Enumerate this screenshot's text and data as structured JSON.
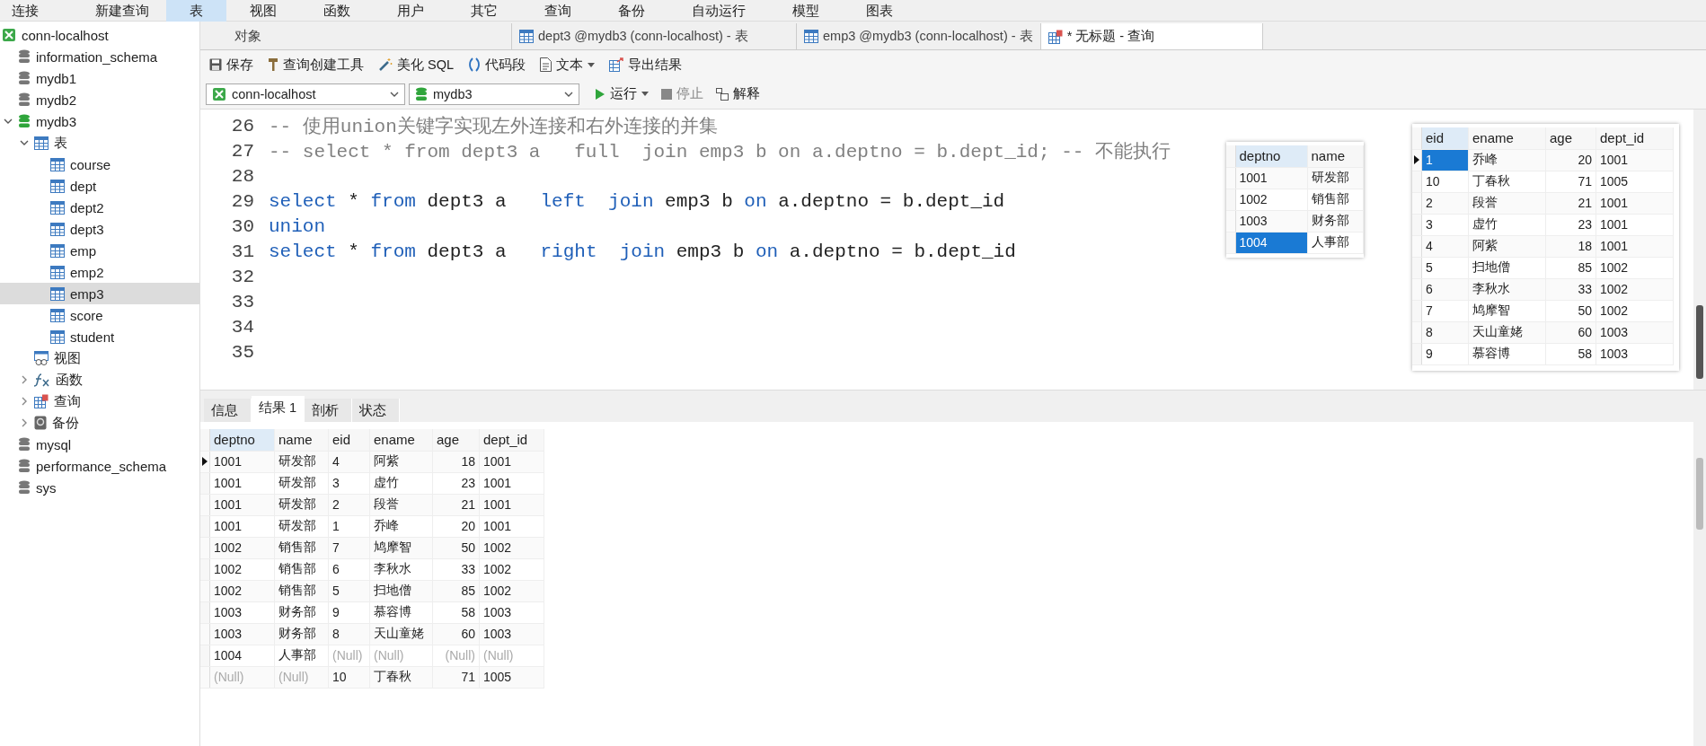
{
  "menu": [
    {
      "label": "连接",
      "selected": false
    },
    {
      "label": "新建查询",
      "selected": false
    },
    {
      "label": "表",
      "selected": true
    },
    {
      "label": "视图",
      "selected": false
    },
    {
      "label": "函数",
      "selected": false
    },
    {
      "label": "用户",
      "selected": false
    },
    {
      "label": "其它",
      "selected": false
    },
    {
      "label": "查询",
      "selected": false
    },
    {
      "label": "备份",
      "selected": false
    },
    {
      "label": "自动运行",
      "selected": false
    },
    {
      "label": "模型",
      "selected": false
    },
    {
      "label": "图表",
      "selected": false
    }
  ],
  "sidebar": {
    "items": [
      {
        "label": "conn-localhost",
        "kind": "connection",
        "selected": false
      },
      {
        "label": "information_schema",
        "kind": "database",
        "open": false,
        "selected": false
      },
      {
        "label": "mydb1",
        "kind": "database",
        "open": false,
        "selected": false
      },
      {
        "label": "mydb2",
        "kind": "database",
        "open": false,
        "selected": false
      },
      {
        "label": "mydb3",
        "kind": "database",
        "open": true,
        "expanded": true,
        "selected": false,
        "children": [
          {
            "label": "表",
            "kind": "tables",
            "expanded": true,
            "selected": false,
            "children": [
              {
                "label": "course",
                "kind": "table",
                "selected": false
              },
              {
                "label": "dept",
                "kind": "table",
                "selected": false
              },
              {
                "label": "dept2",
                "kind": "table",
                "selected": false
              },
              {
                "label": "dept3",
                "kind": "table",
                "selected": false
              },
              {
                "label": "emp",
                "kind": "table",
                "selected": false
              },
              {
                "label": "emp2",
                "kind": "table",
                "selected": false
              },
              {
                "label": "emp3",
                "kind": "table",
                "selected": true
              },
              {
                "label": "score",
                "kind": "table",
                "selected": false
              },
              {
                "label": "student",
                "kind": "table",
                "selected": false
              }
            ]
          },
          {
            "label": "视图",
            "kind": "views",
            "selected": false
          },
          {
            "label": "函数",
            "kind": "functions",
            "expanded": false,
            "selected": false
          },
          {
            "label": "查询",
            "kind": "queries",
            "expanded": false,
            "selected": false
          },
          {
            "label": "备份",
            "kind": "backups",
            "expanded": false,
            "selected": false
          }
        ]
      },
      {
        "label": "mysql",
        "kind": "database",
        "open": false,
        "selected": false
      },
      {
        "label": "performance_schema",
        "kind": "database",
        "open": false,
        "selected": false
      },
      {
        "label": "sys",
        "kind": "database",
        "open": false,
        "selected": false
      }
    ]
  },
  "document_tabs": [
    {
      "label": "对象",
      "kind": "objects",
      "selected": false
    },
    {
      "label": "dept3 @mydb3 (conn-localhost) - 表",
      "kind": "table",
      "selected": false
    },
    {
      "label": "emp3 @mydb3 (conn-localhost) - 表",
      "kind": "table",
      "selected": false
    },
    {
      "label": "* 无标题 - 查询",
      "kind": "query",
      "selected": true
    }
  ],
  "toolbar": [
    {
      "label": "保存",
      "kind": "save"
    },
    {
      "label": "查询创建工具",
      "kind": "builder"
    },
    {
      "label": "美化 SQL",
      "kind": "beautify"
    },
    {
      "label": "代码段",
      "kind": "snippet"
    },
    {
      "label": "文本",
      "kind": "text"
    },
    {
      "label": "导出结果",
      "kind": "export"
    }
  ],
  "query_bar": {
    "connection": "conn-localhost",
    "database": "mydb3",
    "actions": [
      {
        "label": "运行",
        "kind": "run"
      },
      {
        "label": "停止",
        "kind": "stop"
      },
      {
        "label": "解释",
        "kind": "explain"
      }
    ]
  },
  "editor": {
    "lines": [
      {
        "number": "26",
        "tokens": [
          {
            "kind": "comment",
            "text": "-- 使用union关键字实现左外连接和右外连接的并集"
          }
        ]
      },
      {
        "number": "27",
        "tokens": [
          {
            "kind": "comment",
            "text": "-- select * from dept3 a   full  join emp3 b on a.deptno = b.dept_id; -- 不能执行"
          }
        ]
      },
      {
        "number": "28"
      },
      {
        "number": "29",
        "tokens": [
          {
            "kind": "keyword",
            "text": "select"
          },
          {
            "kind": "plain",
            "text": " * "
          },
          {
            "kind": "keyword",
            "text": "from"
          },
          {
            "kind": "plain",
            "text": " dept3 a   "
          },
          {
            "kind": "keyword",
            "text": "left  join"
          },
          {
            "kind": "plain",
            "text": " emp3 b "
          },
          {
            "kind": "keyword",
            "text": "on"
          },
          {
            "kind": "plain",
            "text": " a.deptno = b.dept_id"
          }
        ]
      },
      {
        "number": "30",
        "tokens": [
          {
            "kind": "keyword",
            "text": "union"
          }
        ]
      },
      {
        "number": "31",
        "tokens": [
          {
            "kind": "keyword",
            "text": "select"
          },
          {
            "kind": "plain",
            "text": " * "
          },
          {
            "kind": "keyword",
            "text": "from"
          },
          {
            "kind": "plain",
            "text": " dept3 a   "
          },
          {
            "kind": "keyword",
            "text": "right  join"
          },
          {
            "kind": "plain",
            "text": " emp3 b "
          },
          {
            "kind": "keyword",
            "text": "on"
          },
          {
            "kind": "plain",
            "text": " a.deptno = b.dept_id"
          }
        ]
      },
      {
        "number": "32"
      },
      {
        "number": "33"
      },
      {
        "number": "34"
      },
      {
        "number": "35"
      }
    ]
  },
  "dept_table": {
    "columns": [
      {
        "label": "deptno",
        "numeric": false
      },
      {
        "label": "name",
        "numeric": false
      }
    ],
    "rows": [
      {
        "current": false,
        "selected": false,
        "cells": [
          "1001",
          "研发部"
        ]
      },
      {
        "current": false,
        "selected": false,
        "cells": [
          "1002",
          "销售部"
        ]
      },
      {
        "current": false,
        "selected": false,
        "cells": [
          "1003",
          "财务部"
        ]
      },
      {
        "current": false,
        "selected": true,
        "cells": [
          "1004",
          "人事部"
        ]
      }
    ]
  },
  "emp_table": {
    "columns": [
      {
        "label": "eid",
        "numeric": false
      },
      {
        "label": "ename",
        "numeric": false
      },
      {
        "label": "age",
        "numeric": true
      },
      {
        "label": "dept_id",
        "numeric": false
      }
    ],
    "rows": [
      {
        "current": true,
        "selected": true,
        "cells": [
          "1",
          "乔峰",
          "20",
          "1001"
        ]
      },
      {
        "current": false,
        "selected": false,
        "cells": [
          "10",
          "丁春秋",
          "71",
          "1005"
        ]
      },
      {
        "current": false,
        "selected": false,
        "cells": [
          "2",
          "段誉",
          "21",
          "1001"
        ]
      },
      {
        "current": false,
        "selected": false,
        "cells": [
          "3",
          "虚竹",
          "23",
          "1001"
        ]
      },
      {
        "current": false,
        "selected": false,
        "cells": [
          "4",
          "阿紫",
          "18",
          "1001"
        ]
      },
      {
        "current": false,
        "selected": false,
        "cells": [
          "5",
          "扫地僧",
          "85",
          "1002"
        ]
      },
      {
        "current": false,
        "selected": false,
        "cells": [
          "6",
          "李秋水",
          "33",
          "1002"
        ]
      },
      {
        "current": false,
        "selected": false,
        "cells": [
          "7",
          "鸠摩智",
          "50",
          "1002"
        ]
      },
      {
        "current": false,
        "selected": false,
        "cells": [
          "8",
          "天山童姥",
          "60",
          "1003"
        ]
      },
      {
        "current": false,
        "selected": false,
        "cells": [
          "9",
          "慕容博",
          "58",
          "1003"
        ]
      }
    ]
  },
  "result_tabs": [
    {
      "label": "信息",
      "selected": false
    },
    {
      "label": "结果 1",
      "selected": true
    },
    {
      "label": "剖析",
      "selected": false
    },
    {
      "label": "状态",
      "selected": false
    }
  ],
  "result_table": {
    "columns": [
      {
        "label": "deptno",
        "numeric": false
      },
      {
        "label": "name",
        "numeric": false
      },
      {
        "label": "eid",
        "numeric": false
      },
      {
        "label": "ename",
        "numeric": false
      },
      {
        "label": "age",
        "numeric": true
      },
      {
        "label": "dept_id",
        "numeric": false
      }
    ],
    "rows": [
      {
        "current": true,
        "selected": false,
        "cells": [
          "1001",
          "研发部",
          "4",
          "阿紫",
          "18",
          "1001"
        ]
      },
      {
        "current": false,
        "selected": false,
        "cells": [
          "1001",
          "研发部",
          "3",
          "虚竹",
          "23",
          "1001"
        ]
      },
      {
        "current": false,
        "selected": false,
        "cells": [
          "1001",
          "研发部",
          "2",
          "段誉",
          "21",
          "1001"
        ]
      },
      {
        "current": false,
        "selected": false,
        "cells": [
          "1001",
          "研发部",
          "1",
          "乔峰",
          "20",
          "1001"
        ]
      },
      {
        "current": false,
        "selected": false,
        "cells": [
          "1002",
          "销售部",
          "7",
          "鸠摩智",
          "50",
          "1002"
        ]
      },
      {
        "current": false,
        "selected": false,
        "cells": [
          "1002",
          "销售部",
          "6",
          "李秋水",
          "33",
          "1002"
        ]
      },
      {
        "current": false,
        "selected": false,
        "cells": [
          "1002",
          "销售部",
          "5",
          "扫地僧",
          "85",
          "1002"
        ]
      },
      {
        "current": false,
        "selected": false,
        "cells": [
          "1003",
          "财务部",
          "9",
          "慕容博",
          "58",
          "1003"
        ]
      },
      {
        "current": false,
        "selected": false,
        "cells": [
          "1003",
          "财务部",
          "8",
          "天山童姥",
          "60",
          "1003"
        ]
      },
      {
        "current": false,
        "selected": false,
        "cells": [
          "1004",
          "人事部",
          {
            "text": "(Null)",
            "is_null": true
          },
          {
            "text": "(Null)",
            "is_null": true
          },
          {
            "text": "(Null)",
            "is_null": true
          },
          {
            "text": "(Null)",
            "is_null": true
          }
        ]
      },
      {
        "current": false,
        "selected": false,
        "cells": [
          {
            "text": "(Null)",
            "is_null": true
          },
          {
            "text": "(Null)",
            "is_null": true
          },
          "10",
          "丁春秋",
          "71",
          "1005"
        ]
      }
    ]
  }
}
